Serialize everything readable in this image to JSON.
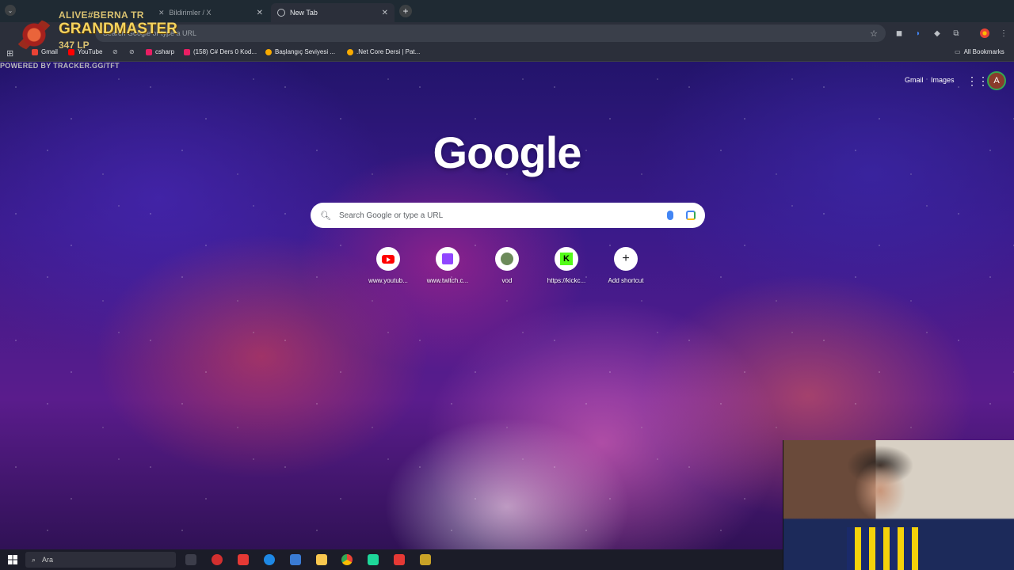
{
  "browser": {
    "tabs": [
      {
        "title": "Bildirimler / X",
        "active": false
      },
      {
        "title": "New Tab",
        "active": true
      }
    ],
    "omnibox_placeholder": "Search Google or type a URL",
    "bookmarks": [
      {
        "label": "Gmail",
        "color": "#ea4335"
      },
      {
        "label": "YouTube",
        "color": "#ff0000"
      },
      {
        "label": "csharp",
        "color": "#e91e63"
      },
      {
        "label": "(158) C# Ders 0 Kod...",
        "color": "#e91e63"
      },
      {
        "label": "Başlangıç Seviyesi ...",
        "color": "#f9ab00"
      },
      {
        "label": ".Net Core Dersi | Pat...",
        "color": "#f9ab00"
      }
    ],
    "all_bookmarks_label": "All Bookmarks"
  },
  "overlay": {
    "summoner": "ALIVE#BERNA TR",
    "tier": "GRANDMASTER",
    "lp": "347 LP",
    "powered_by": "POWERED BY TRACKER.GG/TFT"
  },
  "ntp": {
    "gmail_link": "Gmail",
    "images_link": "Images",
    "avatar_letter": "A",
    "logo_text": "Google",
    "search_placeholder": "Search Google or type a URL",
    "shortcuts": [
      {
        "label": "www.youtub...",
        "icon": "youtube-icon"
      },
      {
        "label": "www.twitch.c...",
        "icon": "twitch-icon"
      },
      {
        "label": "vod",
        "icon": "vod-icon"
      },
      {
        "label": "https://kickc...",
        "icon": "kick-icon"
      },
      {
        "label": "Add shortcut",
        "icon": "plus-icon"
      }
    ]
  },
  "taskbar": {
    "search_placeholder": "Ara"
  },
  "colors": {
    "accent_blue": "#4285f4",
    "toolbar_bg": "#2b2f3a",
    "tier_gold": "#f4d35e"
  }
}
